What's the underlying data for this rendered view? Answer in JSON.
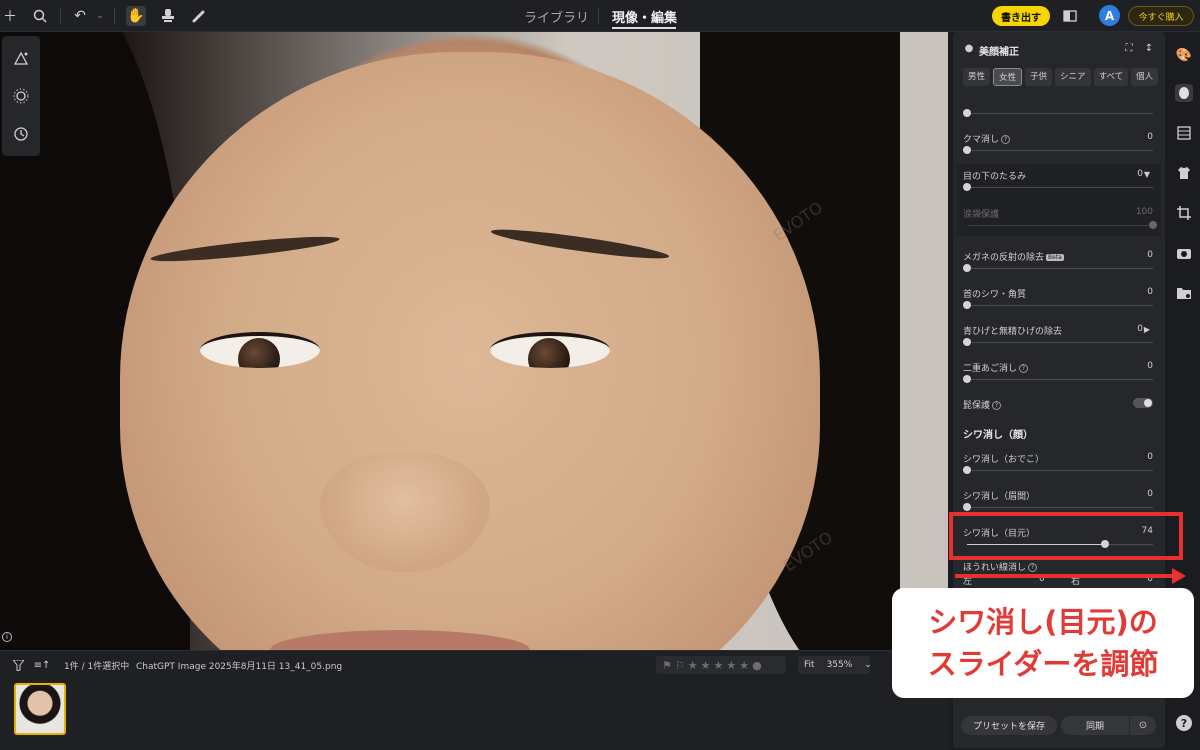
{
  "topbar": {
    "tabs": [
      {
        "label": "ライブラリ",
        "active": false
      },
      {
        "label": "現像・編集",
        "active": true
      }
    ],
    "export_label": "書き出す",
    "avatar_initial": "A",
    "buy_label": "今すぐ購入",
    "icons": [
      "plus-icon",
      "search-icon",
      "undo-icon",
      "chevron-down-icon",
      "hand-icon",
      "stamp-icon",
      "eyedropper-icon",
      "compare-icon"
    ]
  },
  "canvas": {
    "watermark": "EVOTO"
  },
  "filmstrip": {
    "count_text": "1件 / 1件選択中",
    "filename": "ChatGPT Image 2025年8月11日 13_41_05.png",
    "fit_label": "Fit",
    "zoom_label": "355%"
  },
  "panel": {
    "title": "美顔補正",
    "chips": [
      "男性",
      "女性",
      "子供",
      "シニア",
      "すべて",
      "個人"
    ],
    "selected_chip": "女性",
    "rows": {
      "kuma": {
        "label": "クマ消し",
        "value": "0"
      },
      "tarumi": {
        "label": "目の下のたるみ",
        "value": "0"
      },
      "namida": {
        "label": "涙袋保護",
        "value": "100"
      },
      "megane": {
        "label": "メガネの反射の除去",
        "badge": "Beta",
        "value": "0"
      },
      "kubi": {
        "label": "首のシワ・角質",
        "value": "0"
      },
      "aohige": {
        "label": "青ひげと無精ひげの除去",
        "value": "0"
      },
      "nijuu": {
        "label": "二重あご消し",
        "value": "0"
      },
      "hoho": {
        "label": "髭保護"
      }
    },
    "section_wrinkle": "シワ消し（顔）",
    "wrinkle_rows": {
      "odeko": {
        "label": "シワ消し（おでこ）",
        "value": "0"
      },
      "miken": {
        "label": "シワ消し（眉間）",
        "value": "0"
      },
      "memoto": {
        "label": "シワ消し（目元）",
        "value": "74",
        "fraction": 0.74
      }
    },
    "horeisen": {
      "label": "ほうれい線消し",
      "left_label": "左",
      "left_value": "0",
      "right_label": "右",
      "right_value": "0"
    },
    "footer": {
      "save_label": "プリセットを保存",
      "sync_label": "同期"
    }
  },
  "callout": {
    "line1": "シワ消し(目元)の",
    "line2": "スライダーを調節",
    "color": "#e23a35"
  }
}
